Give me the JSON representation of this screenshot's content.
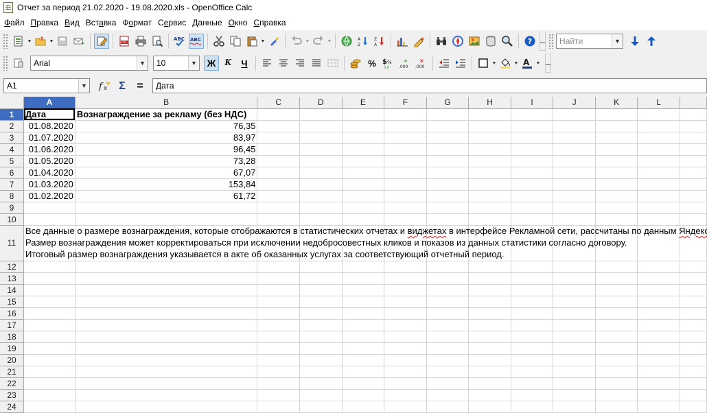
{
  "window": {
    "title": "Отчет за период 21.02.2020 - 19.08.2020.xls - OpenOffice Calc"
  },
  "menu": [
    {
      "pre": "",
      "u": "Ф",
      "post": "айл"
    },
    {
      "pre": "",
      "u": "П",
      "post": "равка"
    },
    {
      "pre": "",
      "u": "В",
      "post": "ид"
    },
    {
      "pre": "Вст",
      "u": "а",
      "post": "вка"
    },
    {
      "pre": "Ф",
      "u": "о",
      "post": "рмат"
    },
    {
      "pre": "С",
      "u": "е",
      "post": "рвис"
    },
    {
      "pre": "",
      "u": "Д",
      "post": "анные"
    },
    {
      "pre": "",
      "u": "О",
      "post": "кно"
    },
    {
      "pre": "",
      "u": "С",
      "post": "правка"
    }
  ],
  "toolbar": {
    "find_placeholder": "Найти",
    "font_name": "Arial",
    "font_size": "10",
    "bold_label": "Ж",
    "italic_label": "К",
    "underline_label": "Ч"
  },
  "formula_bar": {
    "name_box": "A1",
    "content": "Дата"
  },
  "sheet": {
    "columns": [
      "A",
      "B",
      "C",
      "D",
      "E",
      "F",
      "G",
      "H",
      "I",
      "J",
      "K",
      "L"
    ],
    "header_row": [
      "Дата",
      "Вознаграждение за рекламу (без НДС)"
    ],
    "rows": [
      {
        "date": "01.08.2020",
        "value": "76,35"
      },
      {
        "date": "01.07.2020",
        "value": "83,97"
      },
      {
        "date": "01.06.2020",
        "value": "96,45"
      },
      {
        "date": "01.05.2020",
        "value": "73,28"
      },
      {
        "date": "01.04.2020",
        "value": "67,07"
      },
      {
        "date": "01.03.2020",
        "value": "153,84"
      },
      {
        "date": "01.02.2020",
        "value": "61,72"
      }
    ],
    "note_lines": {
      "line1_pre": "Все данные о размере вознаграждения, которые отображаются в статистических отчетах и ",
      "line1_squiggle": "виджетах",
      "line1_post": " в интерфейсе Рекламной сети, рассчитаны по данным ",
      "line1_end": "Яндекса",
      "line2": "Размер вознаграждения может корректироваться при исключении недобросовестных кликов и показов из данных статистики согласно договору.",
      "line3": "Итоговый размер вознаграждения указывается в акте об оказанных услугах за соответствующий отчетный период."
    },
    "row_numbers": [
      "1",
      "2",
      "3",
      "4",
      "5",
      "6",
      "7",
      "8",
      "9",
      "10",
      "11",
      "12",
      "13",
      "14",
      "15",
      "16",
      "17",
      "18",
      "19",
      "20",
      "21",
      "22",
      "23",
      "24"
    ]
  }
}
